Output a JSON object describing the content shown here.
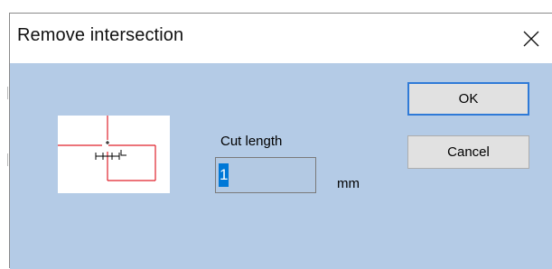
{
  "window": {
    "title": "Remove intersection",
    "close_icon": "close-icon"
  },
  "form": {
    "cut_length_label": "Cut length",
    "cut_length_value": "1",
    "unit": "mm"
  },
  "buttons": {
    "ok_label": "OK",
    "cancel_label": "Cancel"
  },
  "preview": {
    "icon": "intersection-preview-icon"
  },
  "colors": {
    "client_bg": "#b4cbe6",
    "accent": "#0078d7",
    "ok_border": "#2f7ad7",
    "line_red": "#e0202a"
  }
}
